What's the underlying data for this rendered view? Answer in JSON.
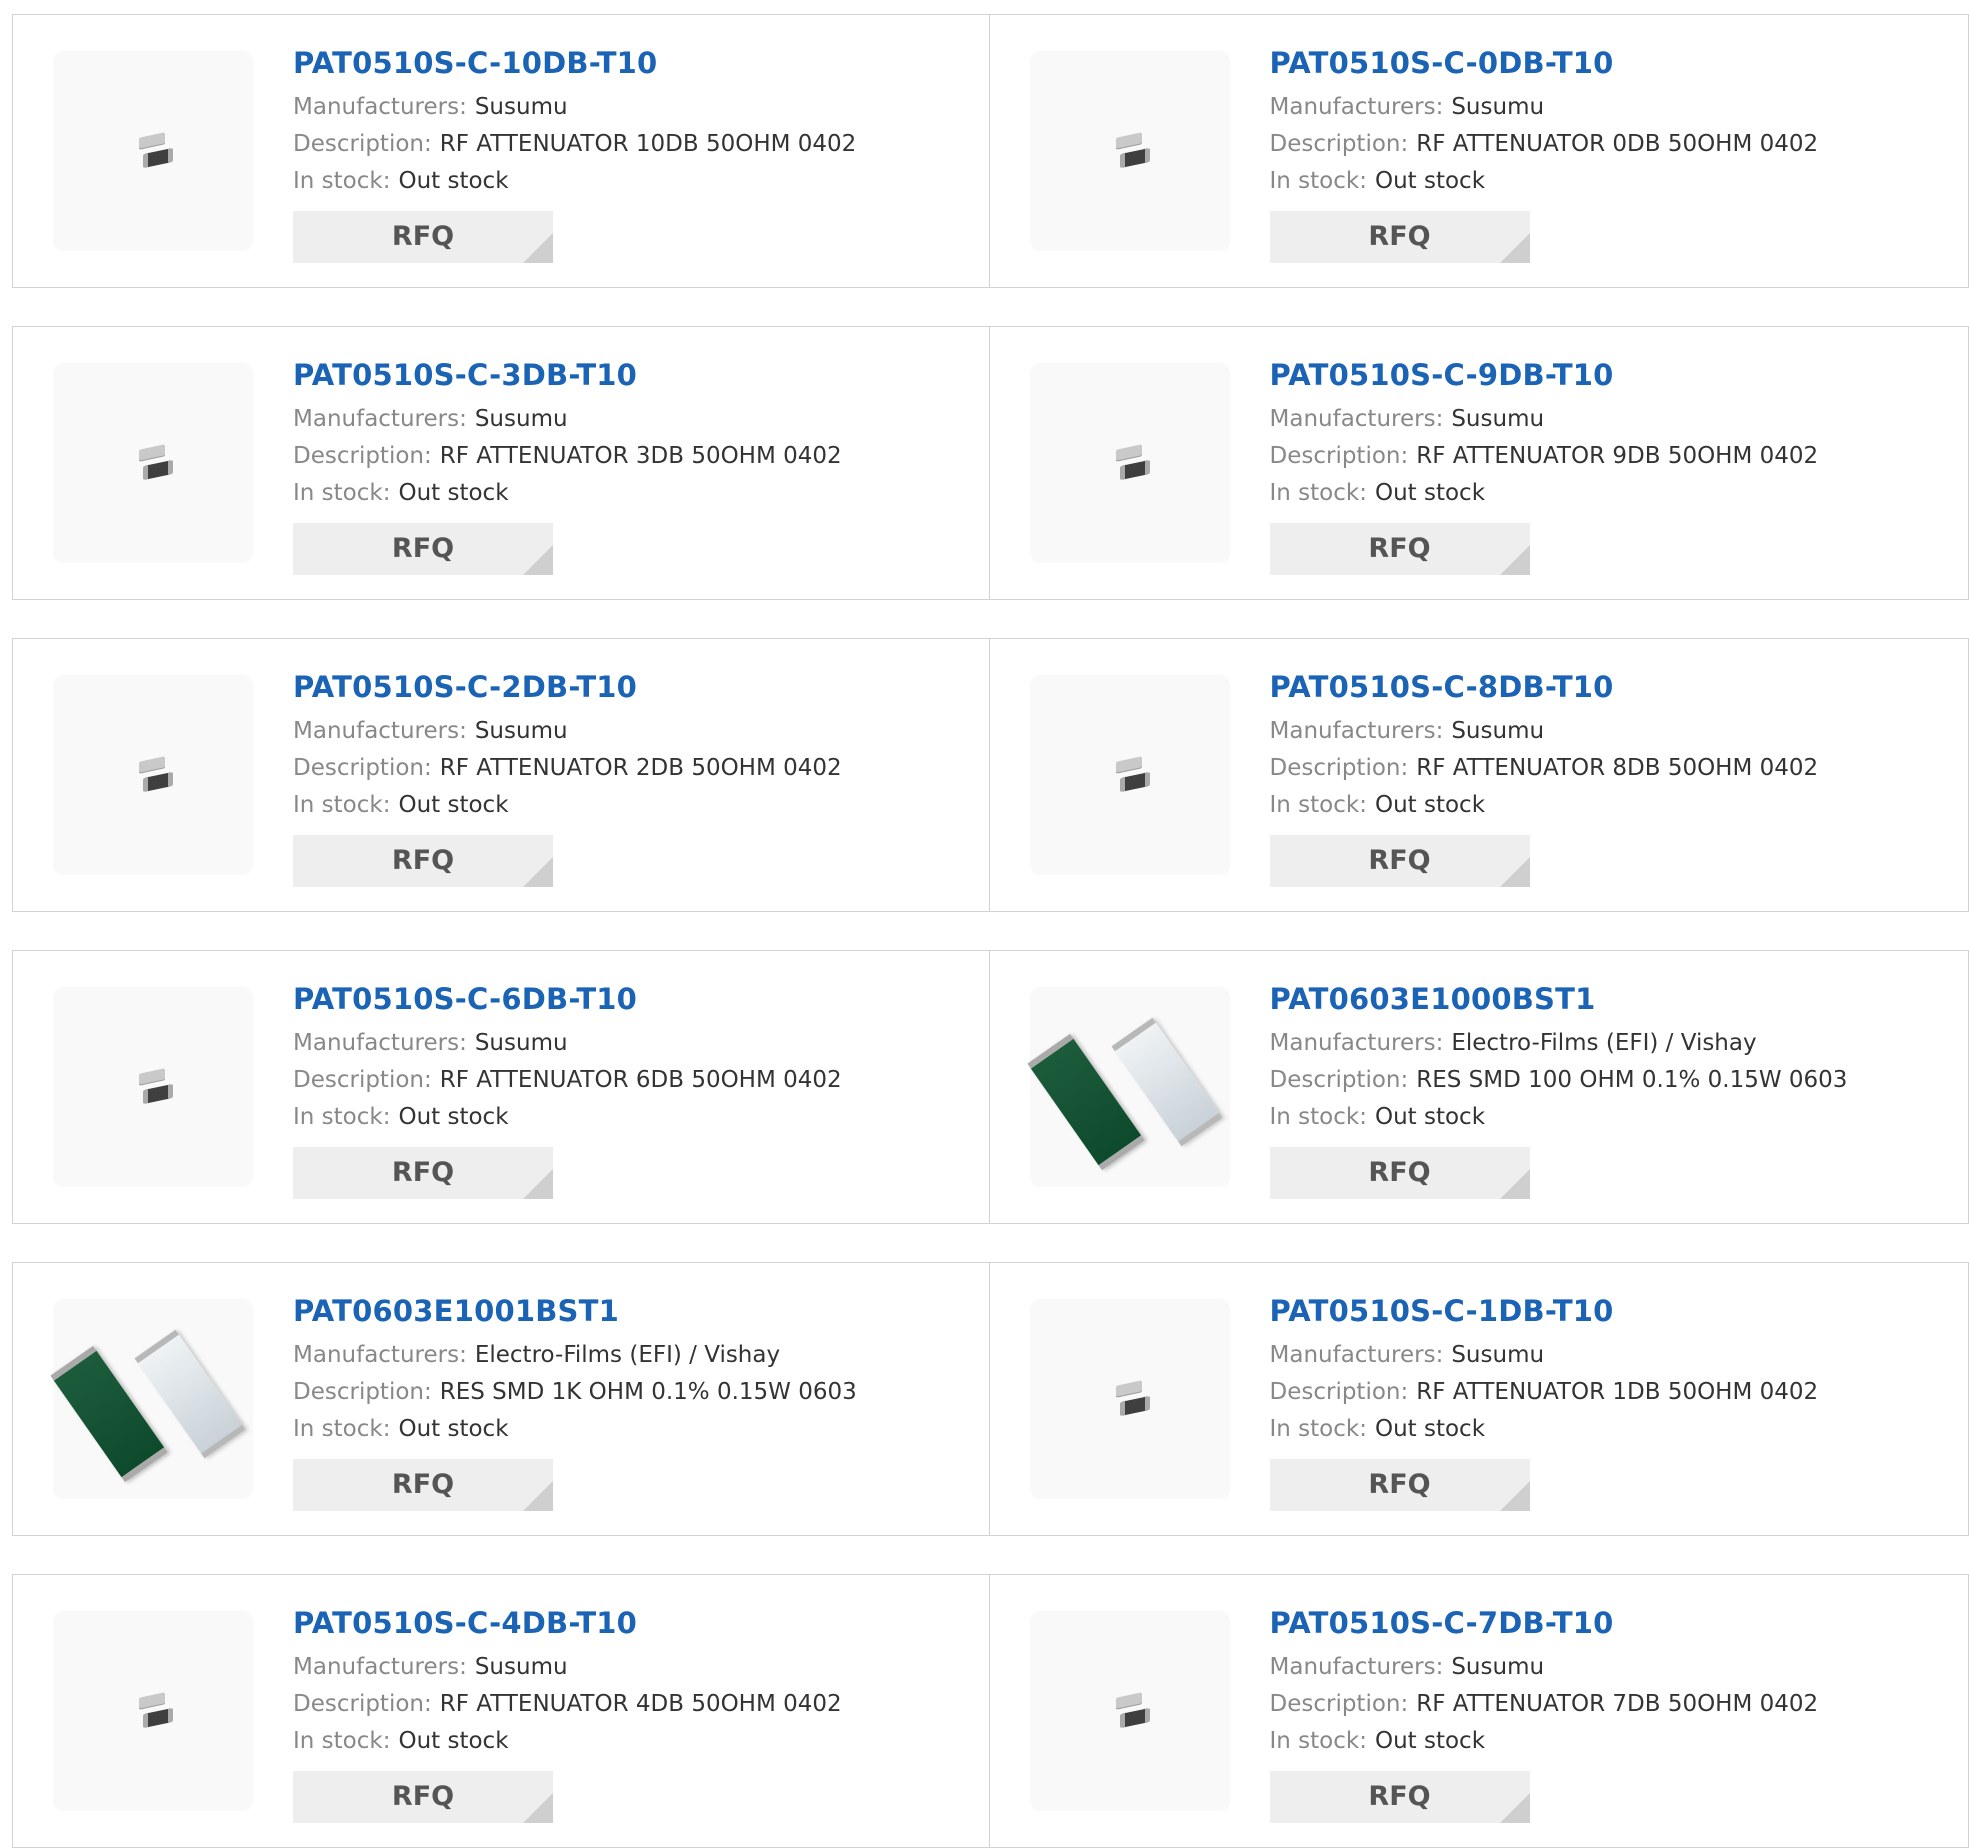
{
  "labels": {
    "manufacturers": "Manufacturers:",
    "description": "Description:",
    "in_stock": "In stock:",
    "rfq": "RFQ"
  },
  "products": [
    {
      "part": "PAT0510S-C-10DB-T10",
      "manufacturer": "Susumu",
      "description": "RF ATTENUATOR 10DB 50OHM 0402",
      "stock": "Out stock",
      "image": "chip-attenuator-icon"
    },
    {
      "part": "PAT0510S-C-0DB-T10",
      "manufacturer": "Susumu",
      "description": "RF ATTENUATOR 0DB 50OHM 0402",
      "stock": "Out stock",
      "image": "chip-attenuator-icon"
    },
    {
      "part": "PAT0510S-C-3DB-T10",
      "manufacturer": "Susumu",
      "description": "RF ATTENUATOR 3DB 50OHM 0402",
      "stock": "Out stock",
      "image": "chip-attenuator-icon"
    },
    {
      "part": "PAT0510S-C-9DB-T10",
      "manufacturer": "Susumu",
      "description": "RF ATTENUATOR 9DB 50OHM 0402",
      "stock": "Out stock",
      "image": "chip-attenuator-icon"
    },
    {
      "part": "PAT0510S-C-2DB-T10",
      "manufacturer": "Susumu",
      "description": "RF ATTENUATOR 2DB 50OHM 0402",
      "stock": "Out stock",
      "image": "chip-attenuator-icon"
    },
    {
      "part": "PAT0510S-C-8DB-T10",
      "manufacturer": "Susumu",
      "description": "RF ATTENUATOR 8DB 50OHM 0402",
      "stock": "Out stock",
      "image": "chip-attenuator-icon"
    },
    {
      "part": "PAT0510S-C-6DB-T10",
      "manufacturer": "Susumu",
      "description": "RF ATTENUATOR 6DB 50OHM 0402",
      "stock": "Out stock",
      "image": "chip-attenuator-icon"
    },
    {
      "part": "PAT0603E1000BST1",
      "manufacturer": "Electro-Films (EFI) / Vishay",
      "description": "RES SMD 100 OHM 0.1% 0.15W 0603",
      "stock": "Out stock",
      "image": "thin-film-resistor-icon"
    },
    {
      "part": "PAT0603E1001BST1",
      "manufacturer": "Electro-Films (EFI) / Vishay",
      "description": "RES SMD 1K OHM 0.1% 0.15W 0603",
      "stock": "Out stock",
      "image": "thin-film-resistor-icon"
    },
    {
      "part": "PAT0510S-C-1DB-T10",
      "manufacturer": "Susumu",
      "description": "RF ATTENUATOR 1DB 50OHM 0402",
      "stock": "Out stock",
      "image": "chip-attenuator-icon"
    },
    {
      "part": "PAT0510S-C-4DB-T10",
      "manufacturer": "Susumu",
      "description": "RF ATTENUATOR 4DB 50OHM 0402",
      "stock": "Out stock",
      "image": "chip-attenuator-icon"
    },
    {
      "part": "PAT0510S-C-7DB-T10",
      "manufacturer": "Susumu",
      "description": "RF ATTENUATOR 7DB 50OHM 0402",
      "stock": "Out stock",
      "image": "chip-attenuator-icon"
    }
  ]
}
